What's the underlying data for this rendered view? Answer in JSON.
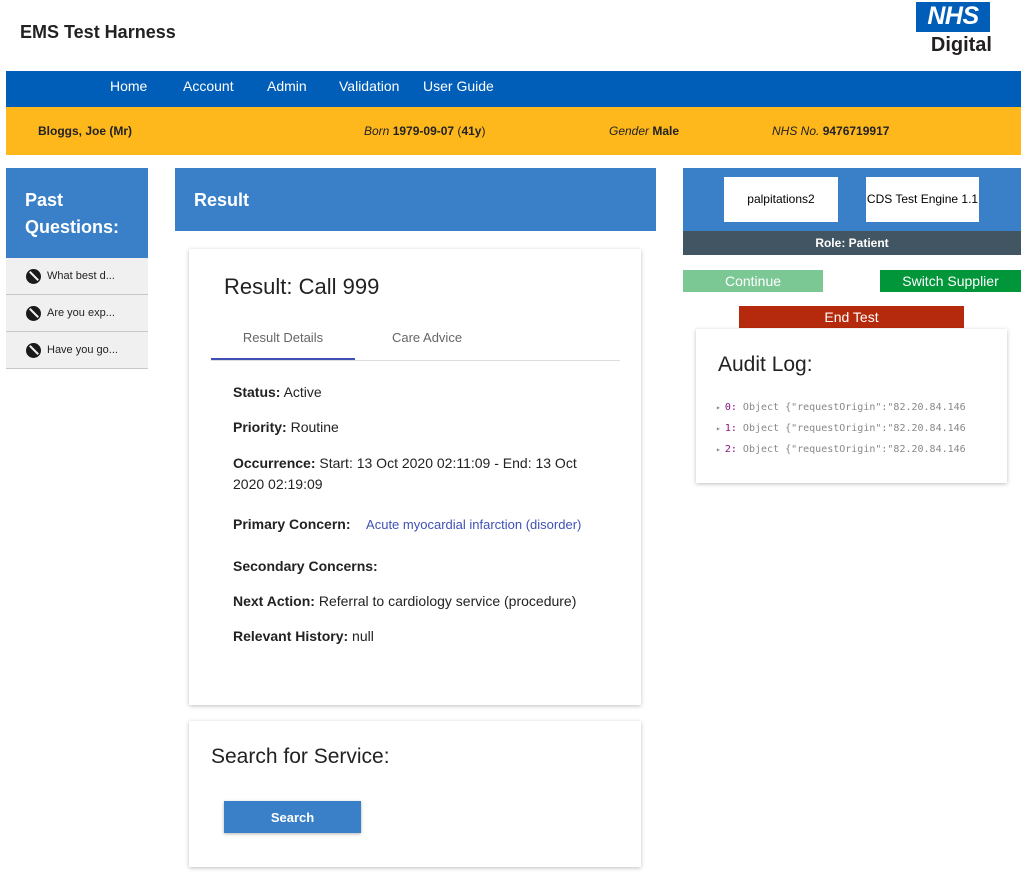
{
  "header": {
    "app_title": "EMS Test Harness",
    "logo": {
      "mark": "NHS",
      "sub": "Digital",
      "color": "#005eb8"
    }
  },
  "nav": {
    "items": [
      {
        "label": "Home"
      },
      {
        "label": "Account"
      },
      {
        "label": "Admin"
      },
      {
        "label": "Validation"
      },
      {
        "label": "User Guide"
      }
    ]
  },
  "patient": {
    "name": "Bloggs, Joe (Mr)",
    "born_label": "Born",
    "dob": "1979-09-07",
    "age": "41y",
    "gender_label": "Gender",
    "gender": "Male",
    "nhs_label": "NHS No.",
    "nhs_number": "9476719917"
  },
  "past_questions": {
    "title": "Past Questions:",
    "items": [
      {
        "label": "What best d...",
        "icon": "visibility-off-icon"
      },
      {
        "label": "Are you exp...",
        "icon": "visibility-off-icon"
      },
      {
        "label": "Have you go...",
        "icon": "visibility-off-icon"
      }
    ]
  },
  "result": {
    "header": "Result",
    "title": "Result: Call 999",
    "tabs": [
      {
        "label": "Result Details",
        "active": true
      },
      {
        "label": "Care Advice",
        "active": false
      }
    ],
    "fields": {
      "status_label": "Status:",
      "status_value": "Active",
      "priority_label": "Priority:",
      "priority_value": "Routine",
      "occurrence_label": "Occurrence:",
      "occurrence_value": "Start: 13 Oct 2020 02:11:09 - End: 13 Oct 2020 02:19:09",
      "primary_label": "Primary Concern:",
      "primary_value": "Acute myocardial infarction (disorder)",
      "secondary_label": "Secondary Concerns:",
      "next_label": "Next Action:",
      "next_value": "Referral to cardiology service (procedure)",
      "history_label": "Relevant History:",
      "history_value": "null"
    }
  },
  "search": {
    "title": "Search for Service:",
    "button": "Search"
  },
  "supplier": {
    "questionnaire": "palpitations2",
    "engine": "CDS Test Engine 1.1",
    "role_label": "Role:",
    "role_value": "Patient"
  },
  "actions": {
    "continue": "Continue",
    "switch_supplier": "Switch Supplier",
    "end_test": "End Test"
  },
  "audit": {
    "title": "Audit Log:",
    "entries": [
      {
        "index": "0",
        "text": "Object {\"requestOrigin\":\"82.20.84.146"
      },
      {
        "index": "1",
        "text": "Object {\"requestOrigin\":\"82.20.84.146"
      },
      {
        "index": "2",
        "text": "Object {\"requestOrigin\":\"82.20.84.146"
      }
    ]
  },
  "colors": {
    "nhs_blue": "#005eb8",
    "panel_blue": "#3a80c8",
    "patient_bar": "#ffb81c",
    "continue": "#7cc894",
    "switch": "#009639",
    "end": "#b52a0c",
    "role_bar": "#425563"
  }
}
